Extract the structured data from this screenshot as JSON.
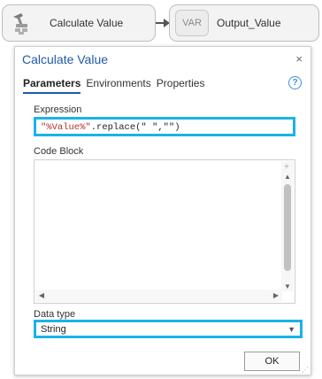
{
  "model": {
    "tool_node": {
      "icon": "hammer-tool-icon",
      "label": "Calculate Value"
    },
    "var_node": {
      "badge": "VAR",
      "label": "Output_Value"
    }
  },
  "dialog": {
    "title": "Calculate Value",
    "close_glyph": "×",
    "tabs": [
      {
        "label": "Parameters",
        "active": true
      },
      {
        "label": "Environments",
        "active": false
      },
      {
        "label": "Properties",
        "active": false
      }
    ],
    "help_glyph": "?",
    "expression": {
      "label": "Expression",
      "value_token": "\"%Value%\"",
      "value_rest": ".replace(\" \",\"\")"
    },
    "code_block": {
      "label": "Code Block",
      "value": ""
    },
    "data_type": {
      "label": "Data type",
      "selected": "String"
    },
    "ok_label": "OK"
  },
  "colors": {
    "accent_blue": "#1f5aa8",
    "highlight_cyan": "#1ab3e8",
    "variable_red": "#b5312c"
  }
}
